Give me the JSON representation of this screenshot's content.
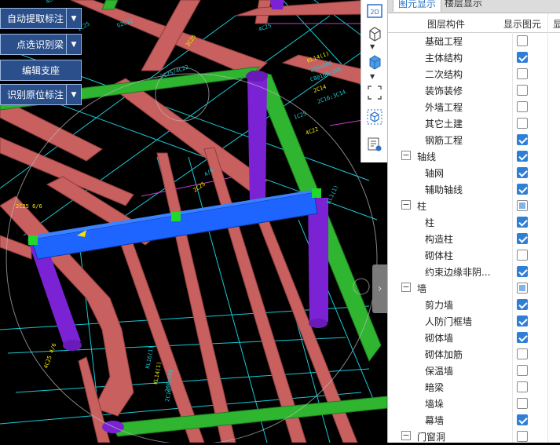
{
  "commands": [
    {
      "label": "自动提取标注",
      "has_arrow": true
    },
    {
      "label": "点选识别梁",
      "has_arrow": true
    },
    {
      "label": "编辑支座",
      "has_arrow": false
    },
    {
      "label": "识别原位标注",
      "has_arrow": true
    }
  ],
  "toolbar": {
    "items": [
      "2d-view-icon",
      "cube-wire-icon",
      "chevron-down-icon",
      "cube-solid-icon",
      "chevron-down-icon",
      "fit-frame-icon",
      "cube-select-icon",
      "layer-list-icon"
    ],
    "label_2d": "2D"
  },
  "panel": {
    "tabs": [
      "图元显示",
      "楼层显示"
    ],
    "active_tab": 0,
    "columns": [
      "图层构件",
      "显示图元",
      "显"
    ],
    "rows": [
      {
        "label": "基础工程",
        "level": 1,
        "checked": "no"
      },
      {
        "label": "主体结构",
        "level": 1,
        "checked": "yes"
      },
      {
        "label": "二次结构",
        "level": 1,
        "checked": "no"
      },
      {
        "label": "装饰装修",
        "level": 1,
        "checked": "no"
      },
      {
        "label": "外墙工程",
        "level": 1,
        "checked": "no"
      },
      {
        "label": "其它土建",
        "level": 1,
        "checked": "no"
      },
      {
        "label": "钢筋工程",
        "level": 1,
        "checked": "yes"
      },
      {
        "label": "轴线",
        "level": 0,
        "checked": "yes"
      },
      {
        "label": "轴网",
        "level": 1,
        "checked": "yes"
      },
      {
        "label": "辅助轴线",
        "level": 1,
        "checked": "yes"
      },
      {
        "label": "柱",
        "level": 0,
        "checked": "partial"
      },
      {
        "label": "柱",
        "level": 1,
        "checked": "yes"
      },
      {
        "label": "构造柱",
        "level": 1,
        "checked": "yes"
      },
      {
        "label": "砌体柱",
        "level": 1,
        "checked": "no"
      },
      {
        "label": "约束边缘非阴...",
        "level": 1,
        "checked": "yes"
      },
      {
        "label": "墙",
        "level": 0,
        "checked": "partial"
      },
      {
        "label": "剪力墙",
        "level": 1,
        "checked": "yes"
      },
      {
        "label": "人防门框墙",
        "level": 1,
        "checked": "yes"
      },
      {
        "label": "砌体墙",
        "level": 1,
        "checked": "yes"
      },
      {
        "label": "砌体加筋",
        "level": 1,
        "checked": "no"
      },
      {
        "label": "保温墙",
        "level": 1,
        "checked": "no"
      },
      {
        "label": "暗梁",
        "level": 1,
        "checked": "no"
      },
      {
        "label": "墙垛",
        "level": 1,
        "checked": "no"
      },
      {
        "label": "幕墙",
        "level": 1,
        "checked": "yes"
      },
      {
        "label": "门窗洞",
        "level": 0,
        "checked": "no"
      }
    ]
  },
  "scene_text": [
    "KL14(1)",
    "250x600",
    "C8@100/200",
    "2C14",
    "2C16;3C14",
    "1C25",
    "4C22",
    "4C25",
    "2C25/4C22",
    "3C25",
    "4C22/2C22",
    "1C25",
    "2C25",
    "4/6",
    "G2C12",
    "2C25 6/6",
    "KL1(1)",
    "KL16(1)",
    "KL14(1)",
    "200x500",
    "2C16",
    "4C25 4/6"
  ],
  "colors": {
    "beam_pink": "#c7605f",
    "beam_selected": "#1e64ff",
    "wall_green": "#2fb52f",
    "column_purple": "#7b22d4",
    "axis_cyan": "#19c9d6",
    "command_blue": "#2a4f8a",
    "check_blue": "#2f7fd6"
  }
}
